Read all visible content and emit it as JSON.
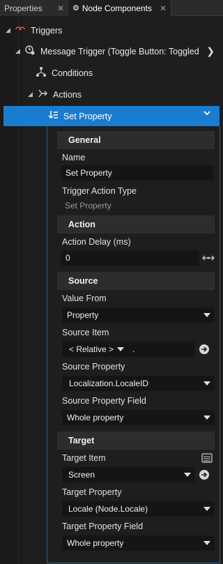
{
  "tabs": [
    {
      "label": "Properties",
      "icon": "properties-icon"
    },
    {
      "label": "Node Components",
      "icon": "node-components-icon"
    }
  ],
  "tree": {
    "triggers": "Triggers",
    "message_trigger": "Message Trigger (Toggle Button: Toggled C",
    "conditions": "Conditions",
    "actions": "Actions",
    "set_property": "Set Property"
  },
  "details": {
    "general": {
      "header": "General",
      "name_label": "Name",
      "name_value": "Set Property",
      "type_label": "Trigger Action Type",
      "type_value": "Set Property"
    },
    "action": {
      "header": "Action",
      "delay_label": "Action Delay (ms)",
      "delay_value": "0"
    },
    "source": {
      "header": "Source",
      "value_from_label": "Value From",
      "value_from_value": "Property",
      "source_item_label": "Source Item",
      "source_item_value": "< Relative >",
      "source_item_path": ".",
      "source_property_label": "Source Property",
      "source_property_value": "Localization.LocaleID",
      "source_property_field_label": "Source Property Field",
      "source_property_field_value": "Whole property"
    },
    "target": {
      "header": "Target",
      "target_item_label": "Target Item",
      "target_item_value": "Screen",
      "target_property_label": "Target Property",
      "target_property_value": "Locale (Node.Locale)",
      "target_property_field_label": "Target Property Field",
      "target_property_field_value": "Whole property"
    }
  },
  "colors": {
    "selection": "#1a7ccf",
    "background": "#1e1e1e",
    "field": "#151515",
    "section": "#2d2d2d"
  }
}
